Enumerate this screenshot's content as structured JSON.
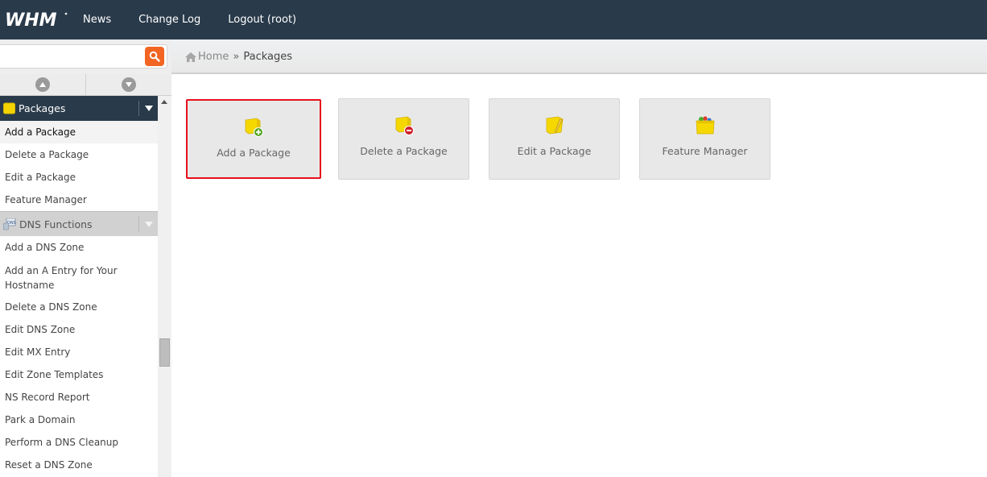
{
  "topbar": {
    "logo_text": "WHM",
    "nav": [
      "News",
      "Change Log",
      "Logout (root)"
    ]
  },
  "search": {
    "value": "",
    "placeholder": "",
    "button_icon": "search-icon"
  },
  "breadcrumb": {
    "home": "Home",
    "separator": "»",
    "current": "Packages"
  },
  "sidebar": {
    "categories": [
      {
        "label": "Packages",
        "icon": "package-icon",
        "expanded": true,
        "items": [
          "Add a Package",
          "Delete a Package",
          "Edit a Package",
          "Feature Manager"
        ]
      },
      {
        "label": "DNS Functions",
        "icon": "dns-icon",
        "expanded": false,
        "items": [
          "Add a DNS Zone",
          "Add an A Entry for Your Hostname",
          "Delete a DNS Zone",
          "Edit DNS Zone",
          "Edit MX Entry",
          "Edit Zone Templates",
          "NS Record Report",
          "Park a Domain",
          "Perform a DNS Cleanup",
          "Reset a DNS Zone"
        ]
      }
    ],
    "selected_item": "Add a Package"
  },
  "tiles": [
    {
      "label": "Add a Package",
      "icon": "package-add-icon",
      "highlighted": true
    },
    {
      "label": "Delete a Package",
      "icon": "package-delete-icon",
      "highlighted": false
    },
    {
      "label": "Edit a Package",
      "icon": "package-edit-icon",
      "highlighted": false
    },
    {
      "label": "Feature Manager",
      "icon": "feature-manager-icon",
      "highlighted": false
    }
  ],
  "colors": {
    "topbar": "#293a4a",
    "search_button": "#f26522",
    "highlight_border": "#e8101b",
    "tile_bg": "#e8e8e8"
  }
}
